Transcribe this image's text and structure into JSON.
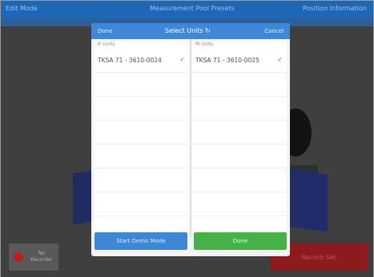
{
  "background": {
    "topbar": {
      "left_text": "Edit Mode",
      "center_text": "Measurement Pool Presets",
      "right_text": "Position Information"
    },
    "left_button": {
      "label": "No Recorder"
    },
    "right_button": {
      "label": "Record Set"
    }
  },
  "dialog": {
    "header": {
      "done_label": "Done",
      "title": "Select Units",
      "refresh_icon": "↻",
      "cancel_label": "Cancel"
    },
    "left_column": {
      "label": "R Units",
      "rows": [
        {
          "text": "TKSA 71 - 3610-0024",
          "selected": true,
          "check": "✓"
        }
      ]
    },
    "right_column": {
      "label": "M Units",
      "rows": [
        {
          "text": "TKSA 71 - 3610-0025",
          "selected": true,
          "check": "✓"
        }
      ]
    },
    "demo_button_label": "Start Demo Mode",
    "done_button_label": "Done"
  },
  "colors": {
    "header_blue": "#3d88d8",
    "done_green": "#46b146",
    "record_red": "#8d1b1e"
  }
}
